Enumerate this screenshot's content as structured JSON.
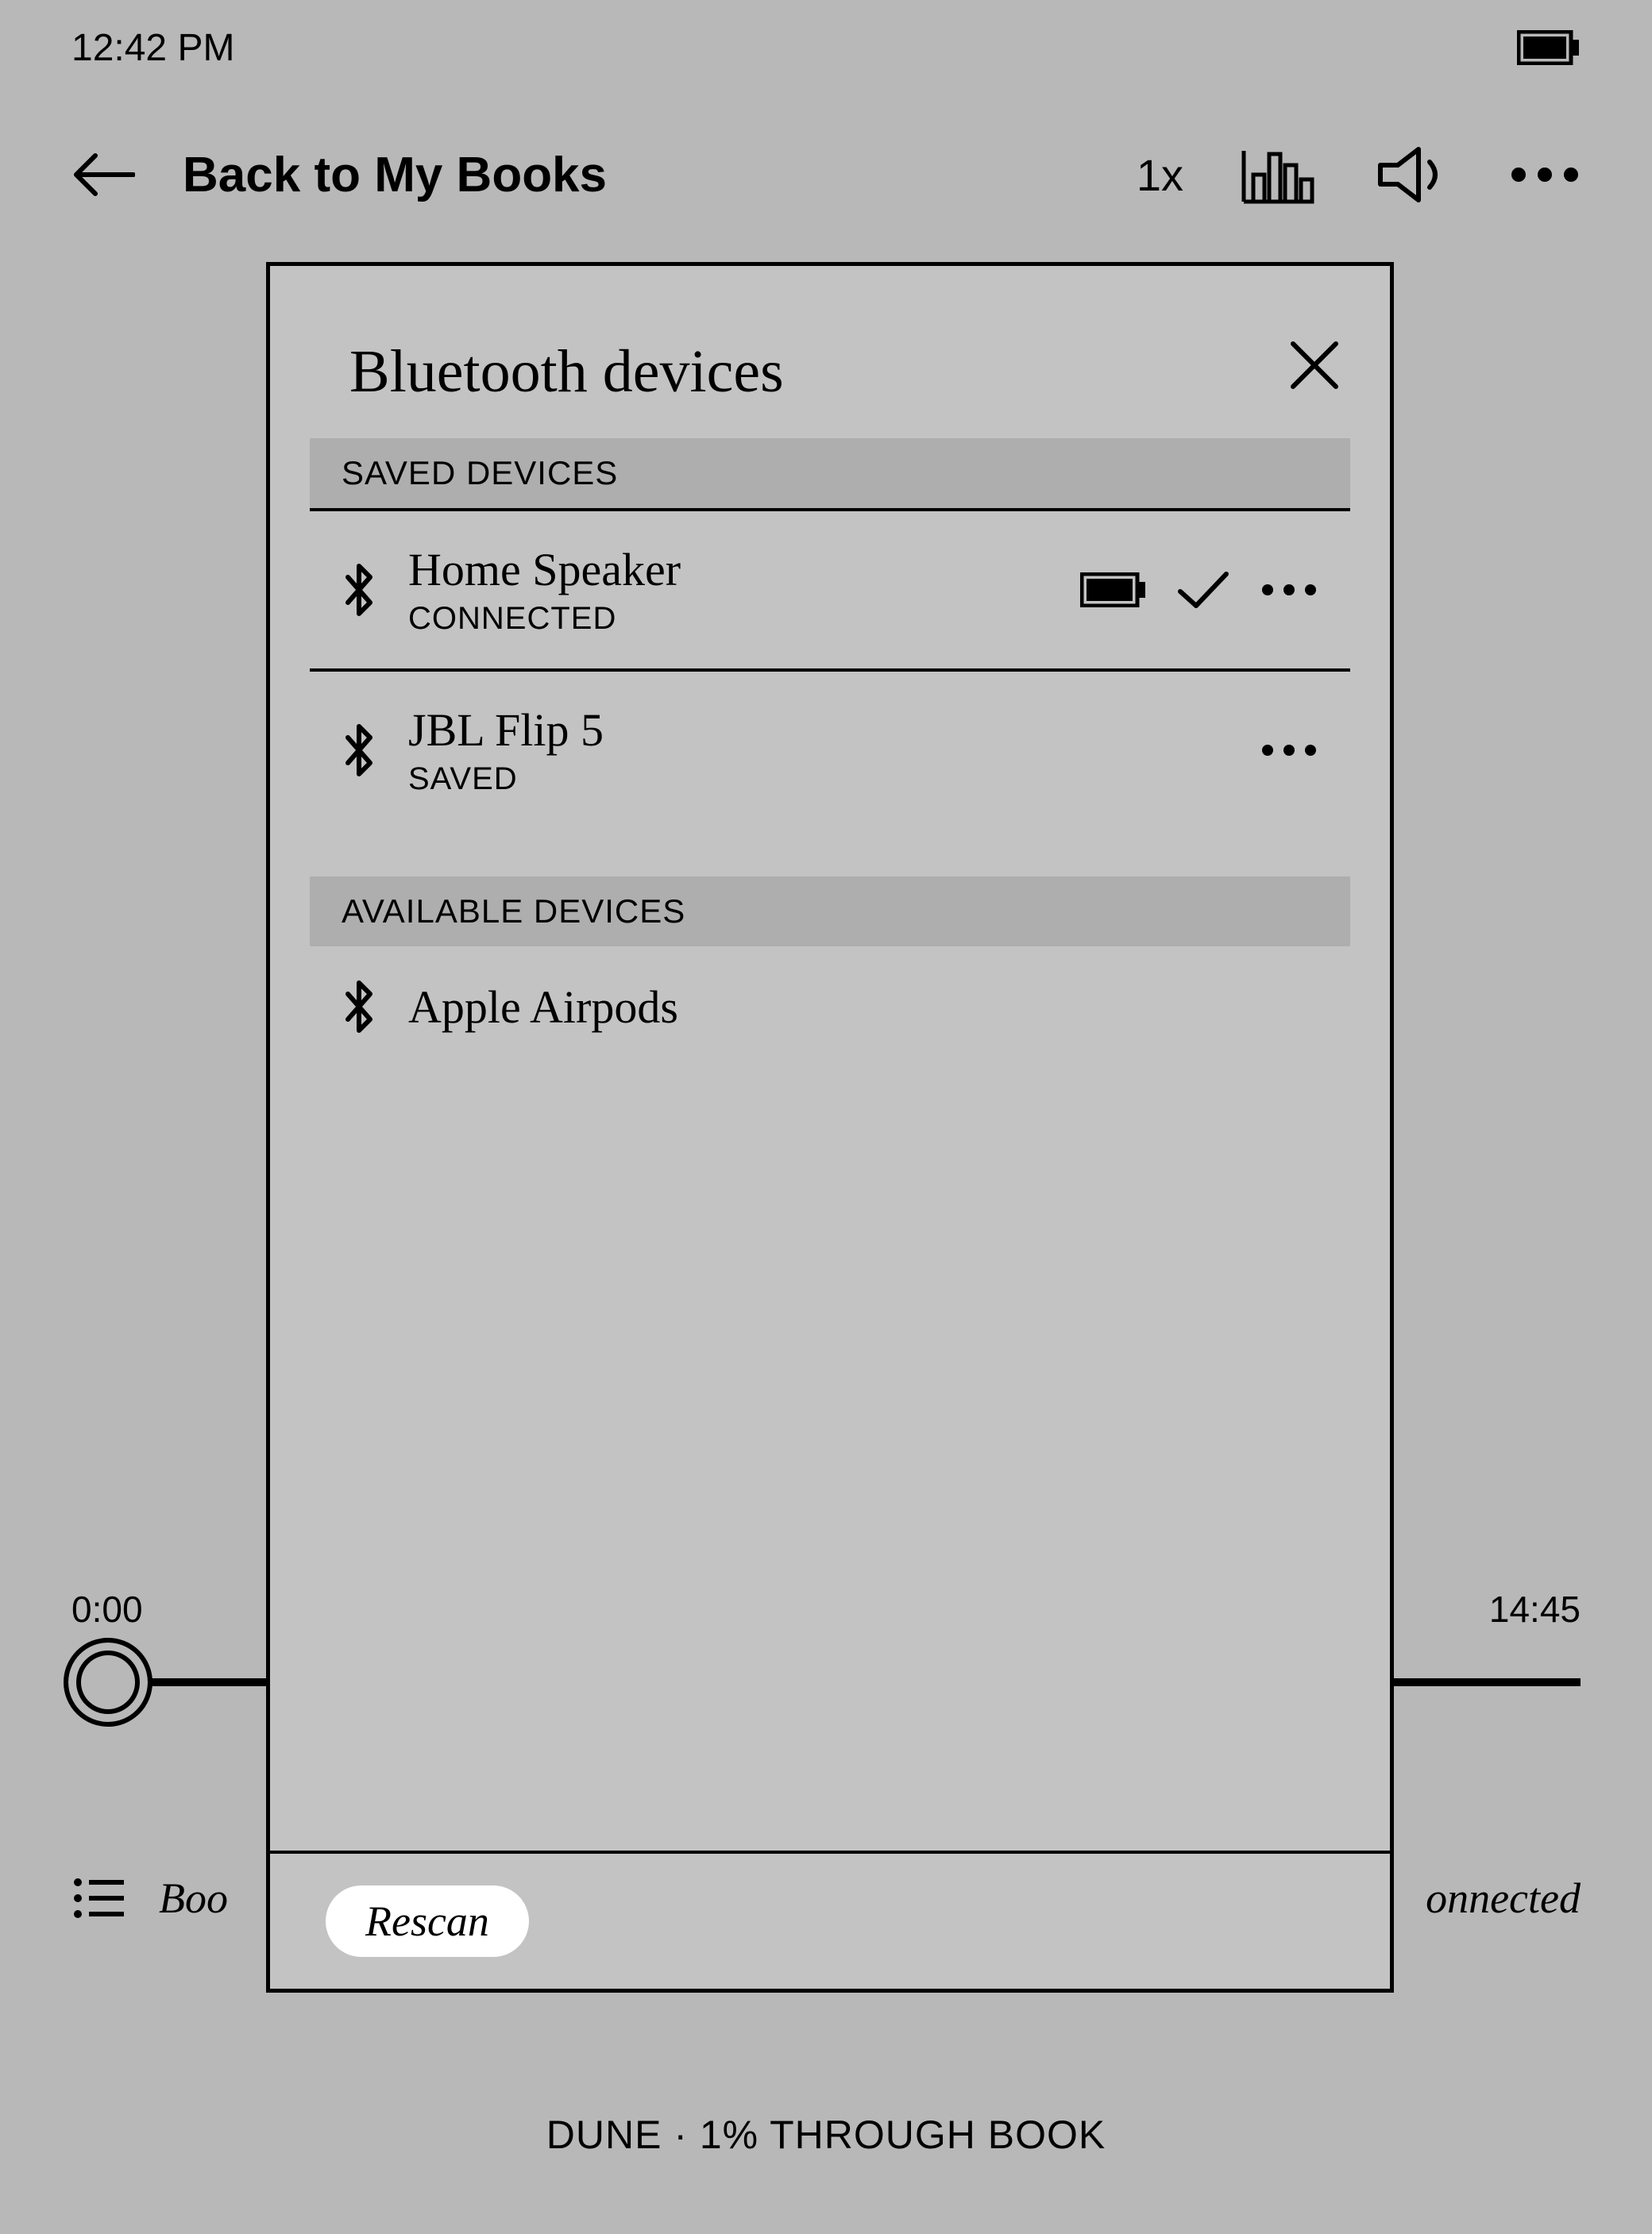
{
  "statusbar": {
    "time": "12:42 PM"
  },
  "nav": {
    "title": "Back to My Books",
    "speed": "1x"
  },
  "player": {
    "elapsed": "0:00",
    "remaining": "14:45"
  },
  "bottom": {
    "left": "Boo",
    "right": "onnected"
  },
  "footer": "DUNE · 1% THROUGH BOOK",
  "modal": {
    "title": "Bluetooth devices",
    "saved_header": "SAVED DEVICES",
    "available_header": "AVAILABLE DEVICES",
    "saved": [
      {
        "name": "Home Speaker",
        "status": "CONNECTED",
        "battery": true,
        "check": true
      },
      {
        "name": "JBL Flip 5",
        "status": "SAVED",
        "battery": false,
        "check": false
      }
    ],
    "available": [
      {
        "name": "Apple Airpods"
      }
    ],
    "rescan": "Rescan"
  }
}
